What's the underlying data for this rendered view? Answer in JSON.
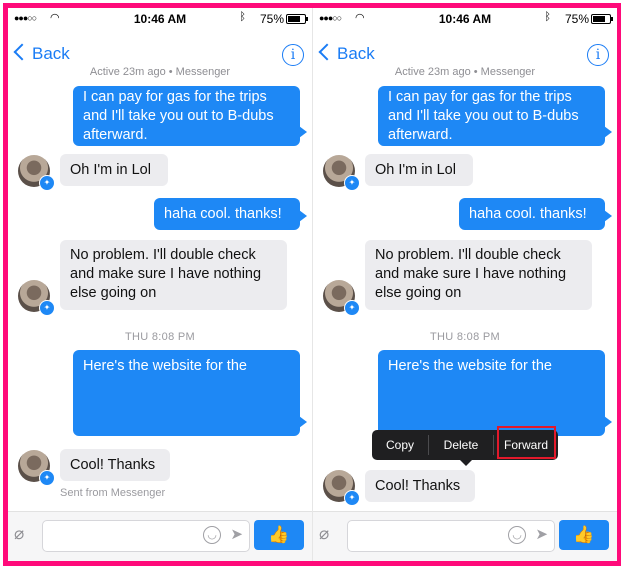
{
  "status": {
    "time": "10:46 AM",
    "battery": "75%",
    "battery_level": 0.75
  },
  "nav": {
    "back_label": "Back",
    "info_icon_label": "i",
    "subtitle": "Active 23m ago • Messenger"
  },
  "messages": {
    "m1": [
      "I can pay for gas for the trips",
      "and I'll take you out to B-dubs",
      "afterward."
    ],
    "m2": "Oh I'm in Lol",
    "m3": "haha cool. thanks!",
    "m4": [
      "No problem. I'll double check",
      "and make sure I have nothing",
      "else going on"
    ],
    "timestamp": "THU 8:08 PM",
    "m5": "Here's the website for the",
    "m6": "Cool! Thanks",
    "sent_from": "Sent from Messenger"
  },
  "context_menu": {
    "copy": "Copy",
    "delete": "Delete",
    "forward": "Forward"
  },
  "colors": {
    "frame": "#ff0a7a",
    "accent": "#1e88f5",
    "highlight": "#e3192b"
  },
  "icons": [
    "paperclip-icon",
    "smiley-icon",
    "send-arrow-icon",
    "thumbs-up-icon",
    "wifi-icon",
    "bluetooth-icon",
    "battery-icon",
    "info-icon",
    "messenger-badge-icon"
  ]
}
